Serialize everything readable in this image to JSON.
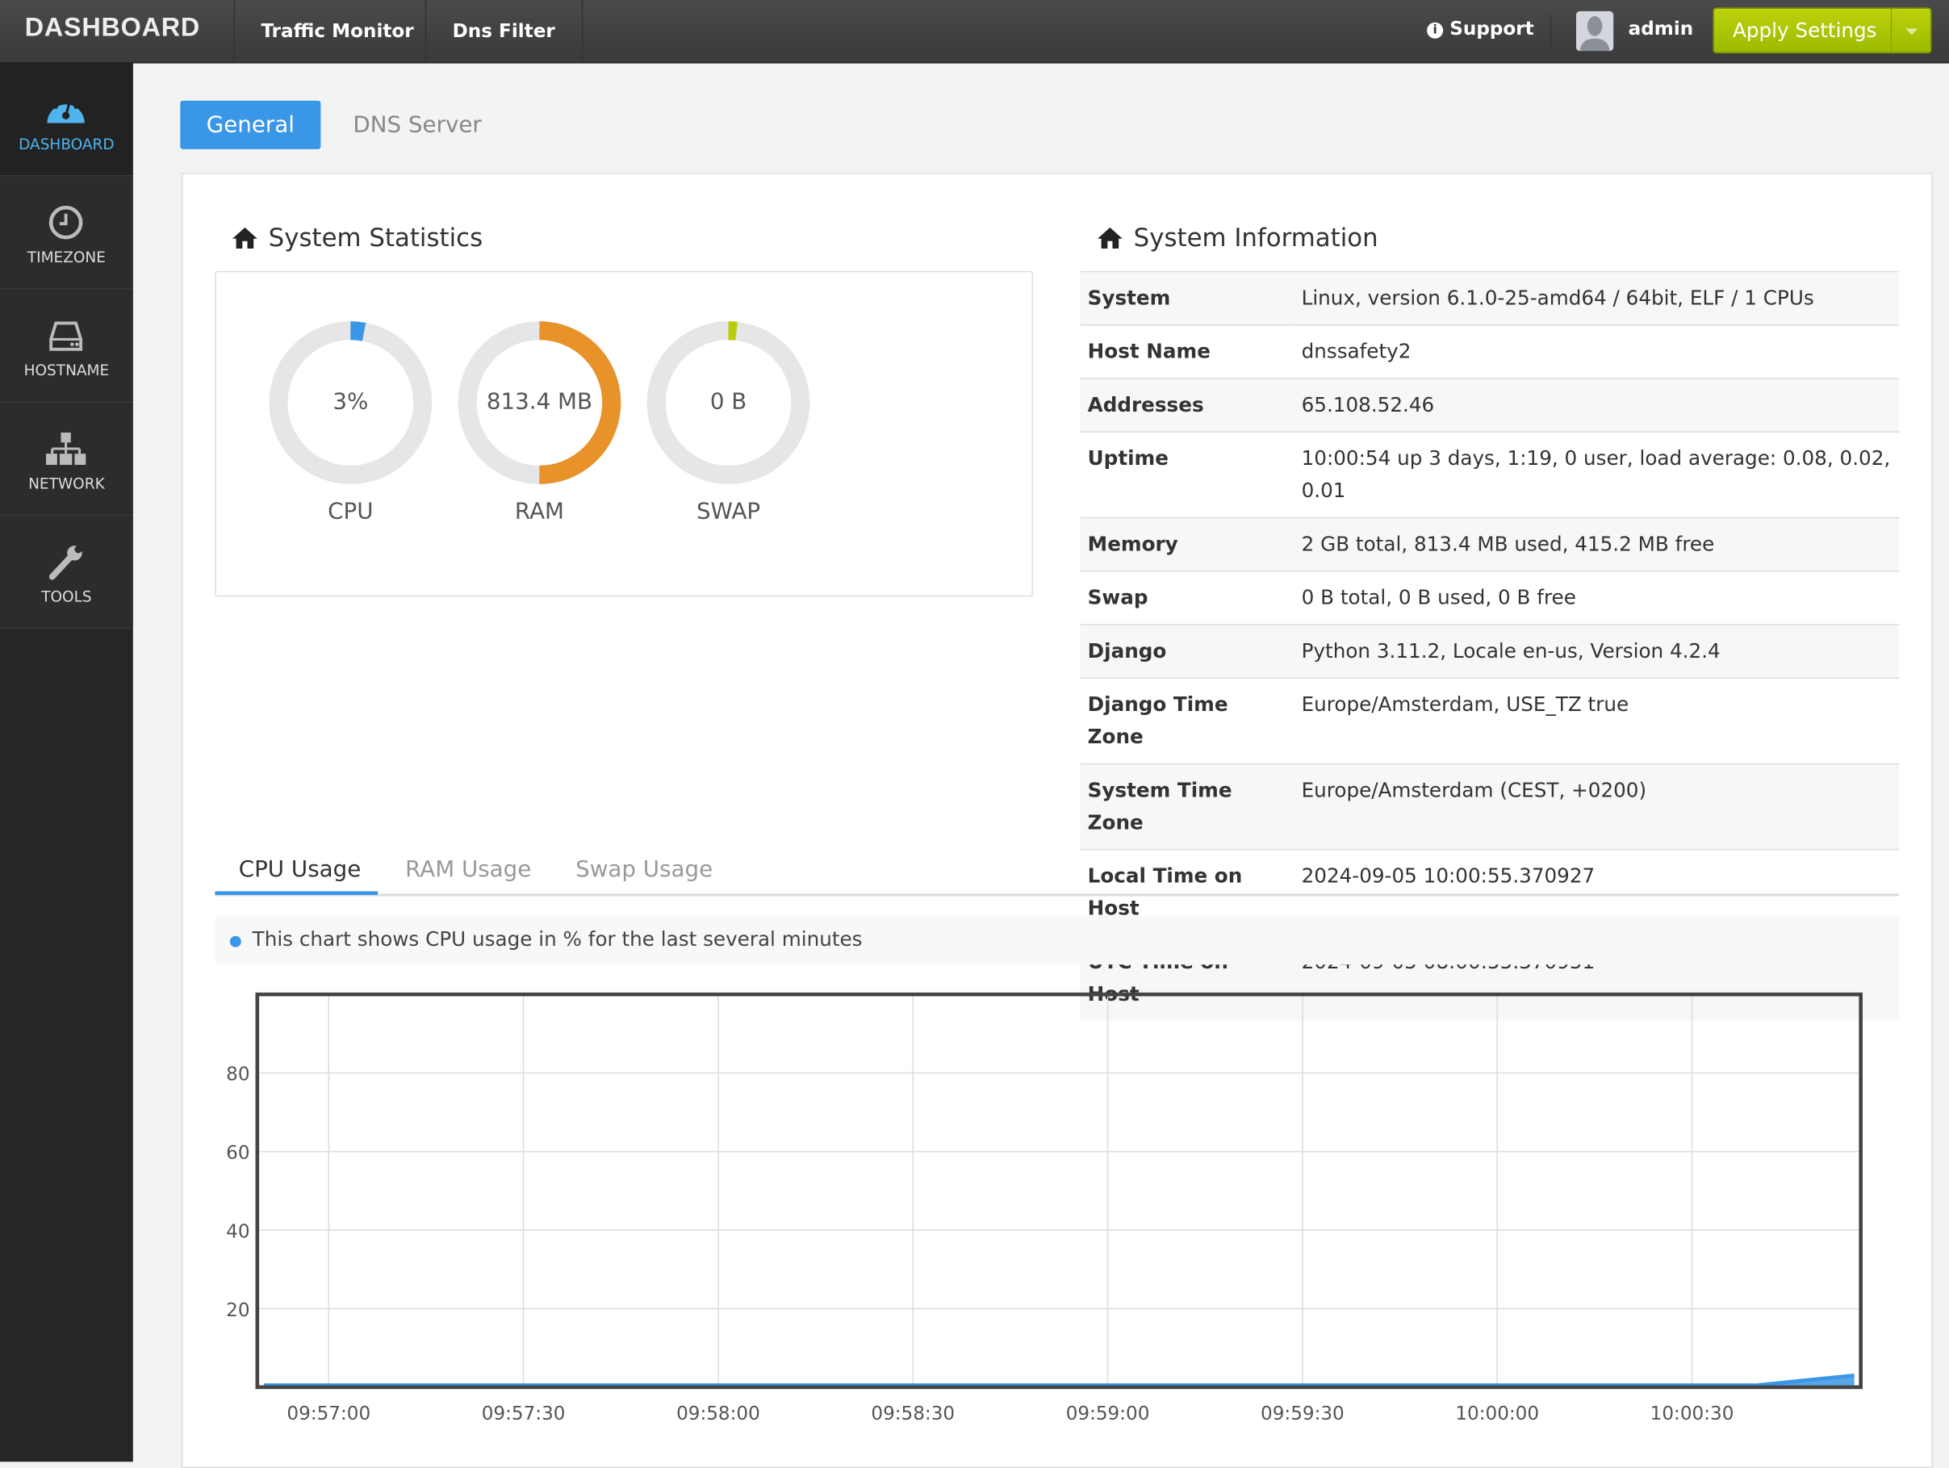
{
  "topbar": {
    "brand": "DASHBOARD",
    "nav": [
      "Traffic Monitor",
      "Dns Filter"
    ],
    "support": "Support",
    "user": "admin",
    "apply": "Apply Settings"
  },
  "sidebar": {
    "items": [
      {
        "label": "DASHBOARD",
        "icon": "dashboard-icon",
        "active": true
      },
      {
        "label": "TIMEZONE",
        "icon": "clock-icon"
      },
      {
        "label": "HOSTNAME",
        "icon": "hard-drive-icon"
      },
      {
        "label": "NETWORK",
        "icon": "sitemap-icon"
      },
      {
        "label": "TOOLS",
        "icon": "wrench-icon"
      }
    ]
  },
  "tabs": {
    "general": "General",
    "dns": "DNS Server"
  },
  "stats": {
    "title": "System Statistics",
    "gauges": [
      {
        "label": "CPU",
        "value": "3%",
        "fraction": 0.03,
        "color": "#3a96e6"
      },
      {
        "label": "RAM",
        "value": "813.4 MB",
        "fraction": 0.5,
        "color": "#e8922a"
      },
      {
        "label": "SWAP",
        "value": "0 B",
        "fraction": 0,
        "color": "#b8cc0a"
      }
    ]
  },
  "info": {
    "title": "System Information",
    "rows": [
      {
        "k": "System",
        "v": "Linux, version 6.1.0-25-amd64 / 64bit, ELF / 1 CPUs"
      },
      {
        "k": "Host Name",
        "v": "dnssafety2"
      },
      {
        "k": "Addresses",
        "v": "65.108.52.46"
      },
      {
        "k": "Uptime",
        "v": "10:00:54 up 3 days, 1:19, 0 user, load average: 0.08, 0.02, 0.01"
      },
      {
        "k": "Memory",
        "v": "2 GB total, 813.4 MB used, 415.2 MB free"
      },
      {
        "k": "Swap",
        "v": "0 B total, 0 B used, 0 B free"
      },
      {
        "k": "Django",
        "v": "Python 3.11.2, Locale en-us, Version 4.2.4"
      },
      {
        "k": "Django Time Zone",
        "v": "Europe/Amsterdam, USE_TZ true"
      },
      {
        "k": "System Time Zone",
        "v": "Europe/Amsterdam (CEST, +0200)"
      },
      {
        "k": "Local Time on Host",
        "v": "2024-09-05 10:00:55.370927"
      },
      {
        "k": "UTC Time on Host",
        "v": "2024-09-05 08:00:55.370951"
      }
    ]
  },
  "chart_tabs": [
    "CPU Usage",
    "RAM Usage",
    "Swap Usage"
  ],
  "chart_note": "This chart shows CPU usage in % for the last several minutes",
  "chart_data": {
    "type": "area",
    "color": "#3a96e6",
    "ylim": [
      0,
      100
    ],
    "yticks": [
      20,
      40,
      60,
      80
    ],
    "grid": true,
    "xticks": [
      "09:57:00",
      "09:57:30",
      "09:58:00",
      "09:58:30",
      "09:59:00",
      "09:59:30",
      "10:00:00",
      "10:00:30"
    ],
    "x": [
      "09:56:50",
      "09:57:00",
      "09:57:30",
      "09:58:00",
      "09:58:30",
      "09:59:00",
      "09:59:30",
      "10:00:00",
      "10:00:30",
      "10:00:40",
      "10:00:55"
    ],
    "values": [
      0.5,
      0.5,
      0.5,
      0.5,
      0.5,
      0.5,
      0.5,
      0.5,
      0.5,
      0.5,
      3
    ]
  }
}
